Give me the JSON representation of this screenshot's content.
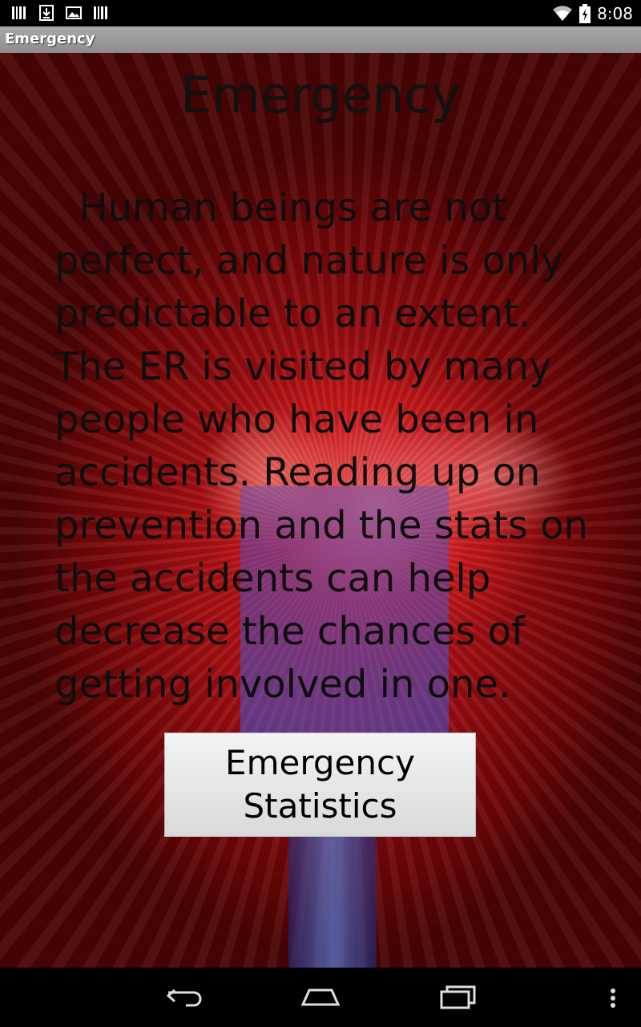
{
  "status_bar": {
    "time": "8:08",
    "left_icons": [
      "barcode-icon",
      "download-icon",
      "image-icon",
      "barcode-icon"
    ],
    "right_icons": [
      "wifi-icon",
      "battery-charging-icon"
    ]
  },
  "title_bar": {
    "title": "Emergency"
  },
  "main": {
    "heading": "Emergency",
    "body": "  Human beings are not perfect, and nature is only predictable to an extent. The ER is visited by many people who have been in accidents. Reading up on prevention and the stats on the accidents can help decrease the chances of getting involved in one.",
    "button_label": "Emergency Statistics"
  },
  "nav_bar": {
    "buttons": [
      "back-icon",
      "home-icon",
      "recent-apps-icon",
      "menu-icon"
    ]
  },
  "colors": {
    "background_red": "#a30f12",
    "text": "#0e0e0e",
    "button_bg": "#e6e6e6"
  }
}
